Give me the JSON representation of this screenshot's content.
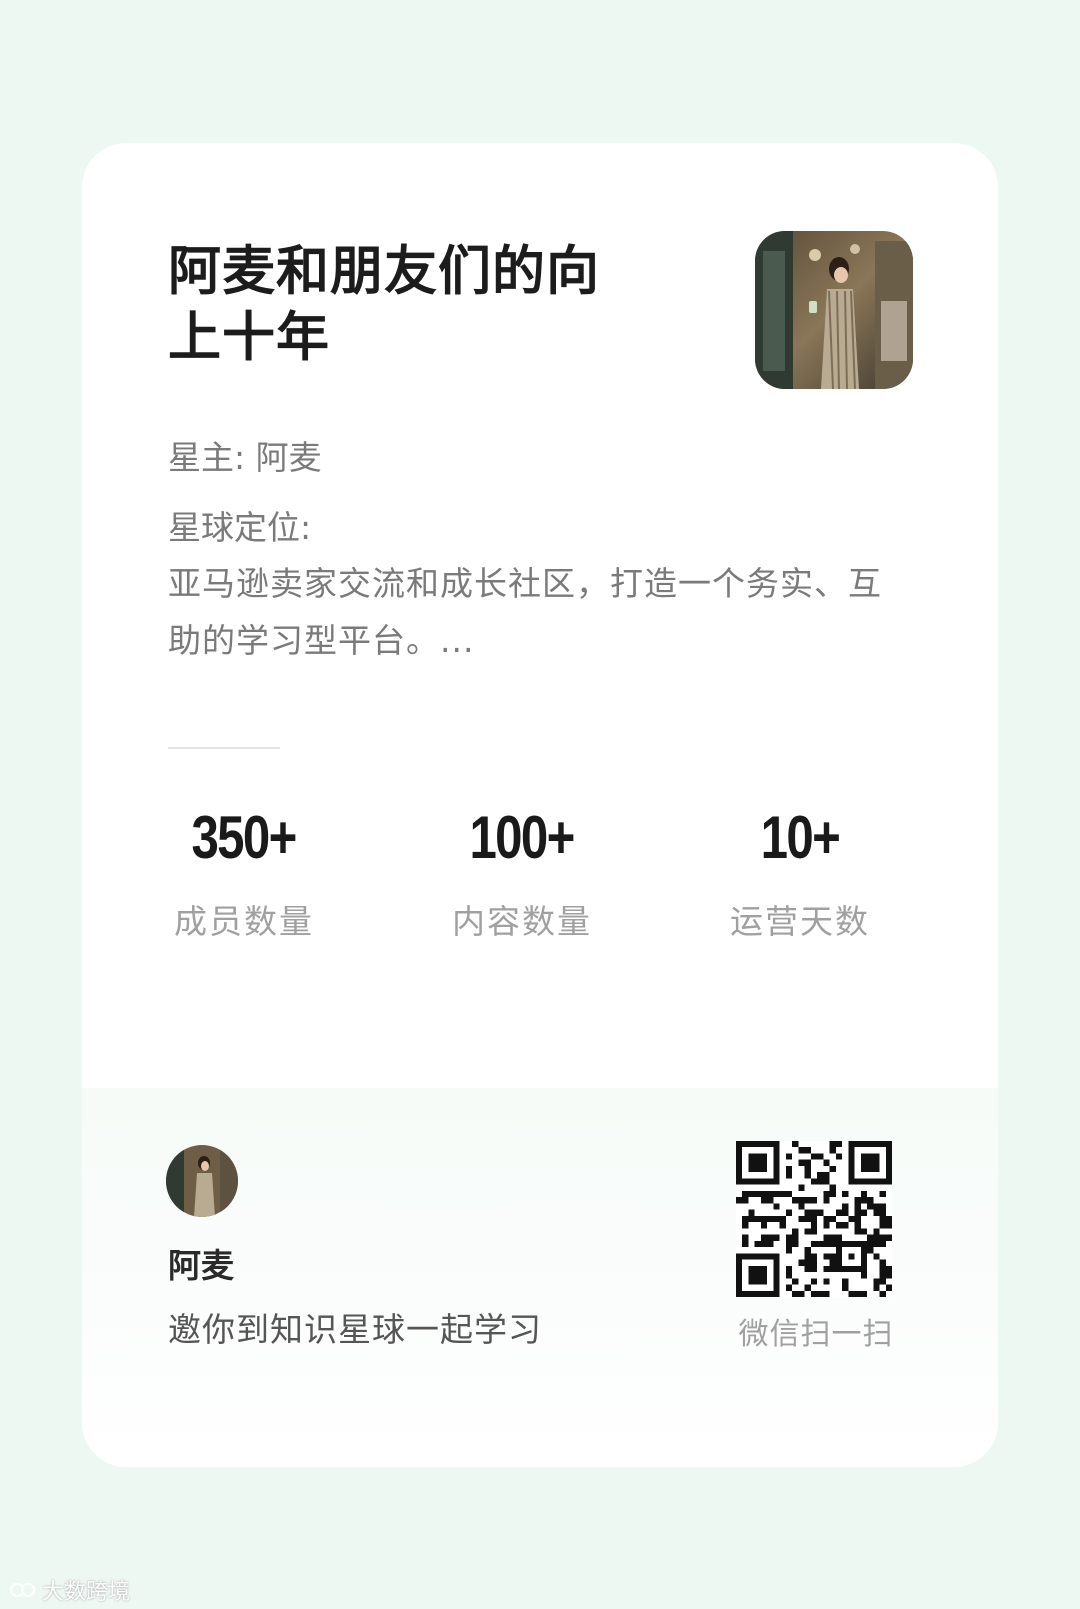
{
  "planet": {
    "title": "阿麦和朋友们的向上十年",
    "owner_label": "星主: 阿麦",
    "positioning_label": "星球定位:",
    "positioning_text": "亚马逊卖家交流和成长社区，打造一个务实、互助的学习型平台。..."
  },
  "stats": [
    {
      "value": "350+",
      "label": "成员数量"
    },
    {
      "value": "100+",
      "label": "内容数量"
    },
    {
      "value": "10+",
      "label": "运营天数"
    }
  ],
  "invite": {
    "name": "阿麦",
    "text": "邀你到知识星球一起学习",
    "qr_label": "微信扫一扫"
  },
  "watermark": "大数跨境",
  "colors": {
    "background": "#eef8f3",
    "card": "#ffffff",
    "title": "#1c1c1c",
    "muted": "#7a7a7a"
  }
}
